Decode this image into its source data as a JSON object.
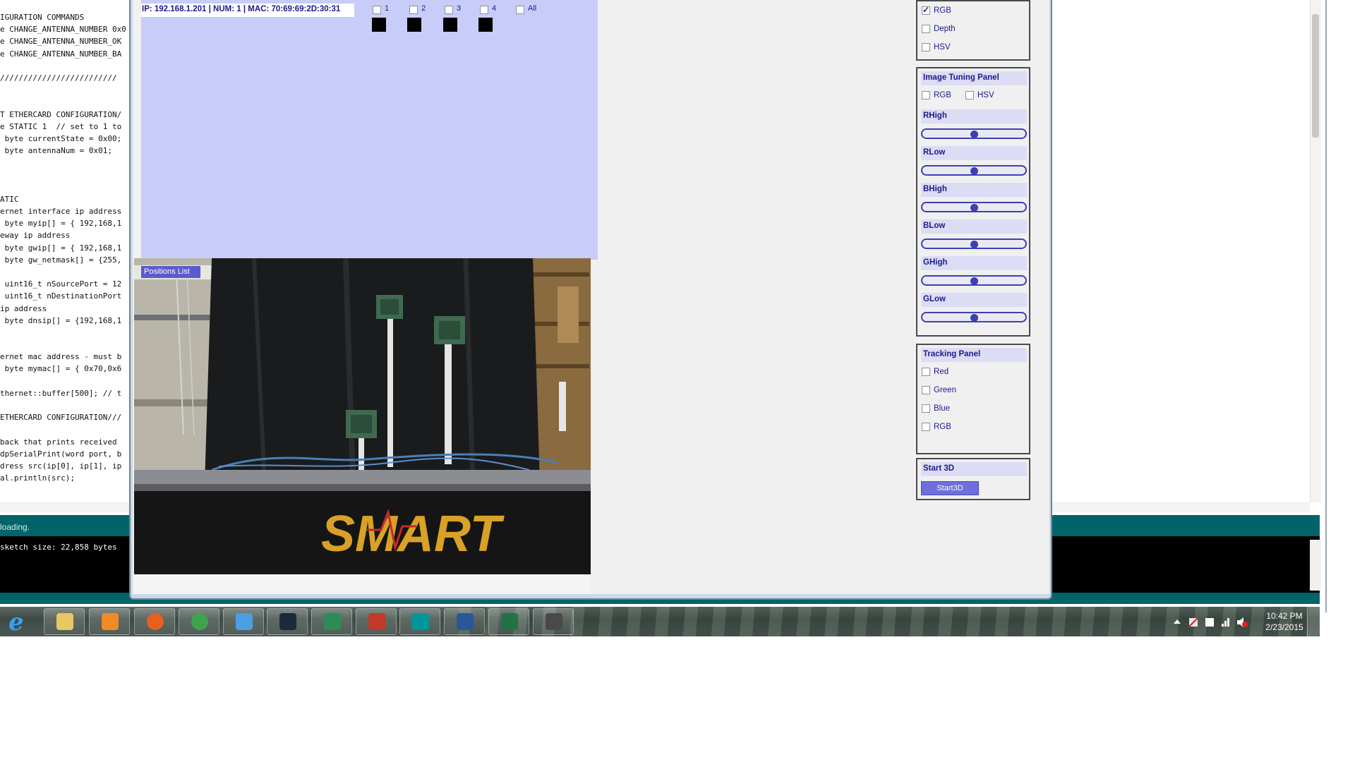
{
  "ide": {
    "code_lines": [
      "IGURATION COMMANDS",
      "e CHANGE_ANTENNA_NUMBER 0x0",
      "e CHANGE_ANTENNA_NUMBER_OK",
      "e CHANGE_ANTENNA_NUMBER_BA",
      "",
      "/////////////////////////",
      "",
      "",
      "T ETHERCARD CONFIGURATION/",
      "e STATIC 1  // set to 1 to",
      " byte currentState = 0x00;",
      " byte antennaNum = 0x01;",
      "",
      "",
      "",
      "ATIC",
      "ernet interface ip address",
      " byte myip[] = { 192,168,1",
      "eway ip address",
      " byte gwip[] = { 192,168,1",
      " byte gw_netmask[] = {255,",
      "",
      " uint16_t nSourcePort = 12",
      " uint16_t nDestinationPort",
      "ip address",
      " byte dnsip[] = {192,168,1",
      "",
      "",
      "ernet mac address - must b",
      " byte mymac[] = { 0x70,0x6",
      "",
      "thernet::buffer[500]; // t",
      "",
      "ETHERCARD CONFIGURATION///",
      "",
      "back that prints received",
      "dpSerialPrint(word port, b",
      "dress src(ip[0], ip[1], ip",
      "al.println(src);"
    ],
    "status_text": "loading.",
    "console_text": "sketch size: 22,858 bytes"
  },
  "info": {
    "text": "IP: 192.168.1.201 | NUM: 1 | MAC: 70:69:69:2D:30:31",
    "antennas": [
      "1",
      "2",
      "3",
      "4"
    ],
    "all_label": "All"
  },
  "camera": {
    "positions_label": "Positions List",
    "brand_text": "SMART"
  },
  "panels": {
    "view": {
      "items": [
        {
          "label": "RGB",
          "checked": true
        },
        {
          "label": "Depth",
          "checked": false
        },
        {
          "label": "HSV",
          "checked": false
        }
      ]
    },
    "tuning": {
      "title": "Image Tuning Panel",
      "rgb_label": "RGB",
      "hsv_label": "HSV",
      "sliders": [
        {
          "label": "RHigh",
          "value": 0.5
        },
        {
          "label": "RLow",
          "value": 0.5
        },
        {
          "label": "BHigh",
          "value": 0.5
        },
        {
          "label": "BLow",
          "value": 0.5
        },
        {
          "label": "GHigh",
          "value": 0.5
        },
        {
          "label": "GLow",
          "value": 0.5
        }
      ]
    },
    "tracking": {
      "title": "Tracking Panel",
      "items": [
        "Red",
        "Green",
        "Blue",
        "RGB"
      ]
    },
    "start3d": {
      "title": "Start 3D",
      "button_label": "Start3D"
    }
  },
  "taskbar": {
    "apps": [
      "internet-explorer",
      "file-explorer",
      "media-player",
      "firefox",
      "chrome",
      "finder",
      "pandora",
      "app-green",
      "app-red",
      "arduino",
      "word",
      "excel",
      "processing"
    ],
    "time": "10:42 PM",
    "date": "2/23/2015"
  },
  "colors": {
    "panel_text": "#1b1b8c",
    "slider_accent": "#3d3fb3",
    "info_bg": "#c8ccf8",
    "button_bg": "#6e6edc",
    "ide_status": "#006468"
  }
}
